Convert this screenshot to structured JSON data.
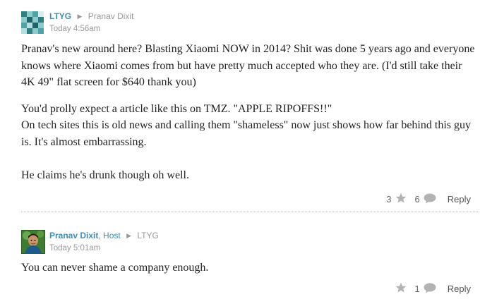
{
  "comments": [
    {
      "author": "LTYG",
      "reply_to": "Pranav Dixit",
      "time": "Today 4:56am",
      "paragraphs": [
        "Pranav's new around here? Blasting Xiaomi NOW in 2014? Shit was done 5 years ago and everyone knows where Xiaomi comes from but have pretty much accepted who they are. (I'd still take their 4K 49\" flat screen for $640 thank you)",
        "You'd prolly expect a article like this on TMZ. \"APPLE RIPOFFS!!\"\nOn tech sites this is old news and calling them \"shameless\" now just shows how far behind this guy is. It's almost embarrassing.",
        "He claims he's drunk though oh well."
      ],
      "likes": "3",
      "replies": "6",
      "reply_label": "Reply"
    },
    {
      "author": "Pranav Dixit",
      "author_role": ", Host",
      "reply_to": "LTYG",
      "time": "Today 5:01am",
      "paragraphs": [
        "You can never shame a company enough."
      ],
      "likes": "",
      "replies": "1",
      "reply_label": "Reply"
    }
  ],
  "icons": {
    "star": "star-icon",
    "bubble": "comment-bubble-icon",
    "arrow": "right-arrow-icon"
  },
  "colors": {
    "author_link": "#3c8dbc",
    "muted": "#999999",
    "avatar_teal": "#2f7f82"
  }
}
